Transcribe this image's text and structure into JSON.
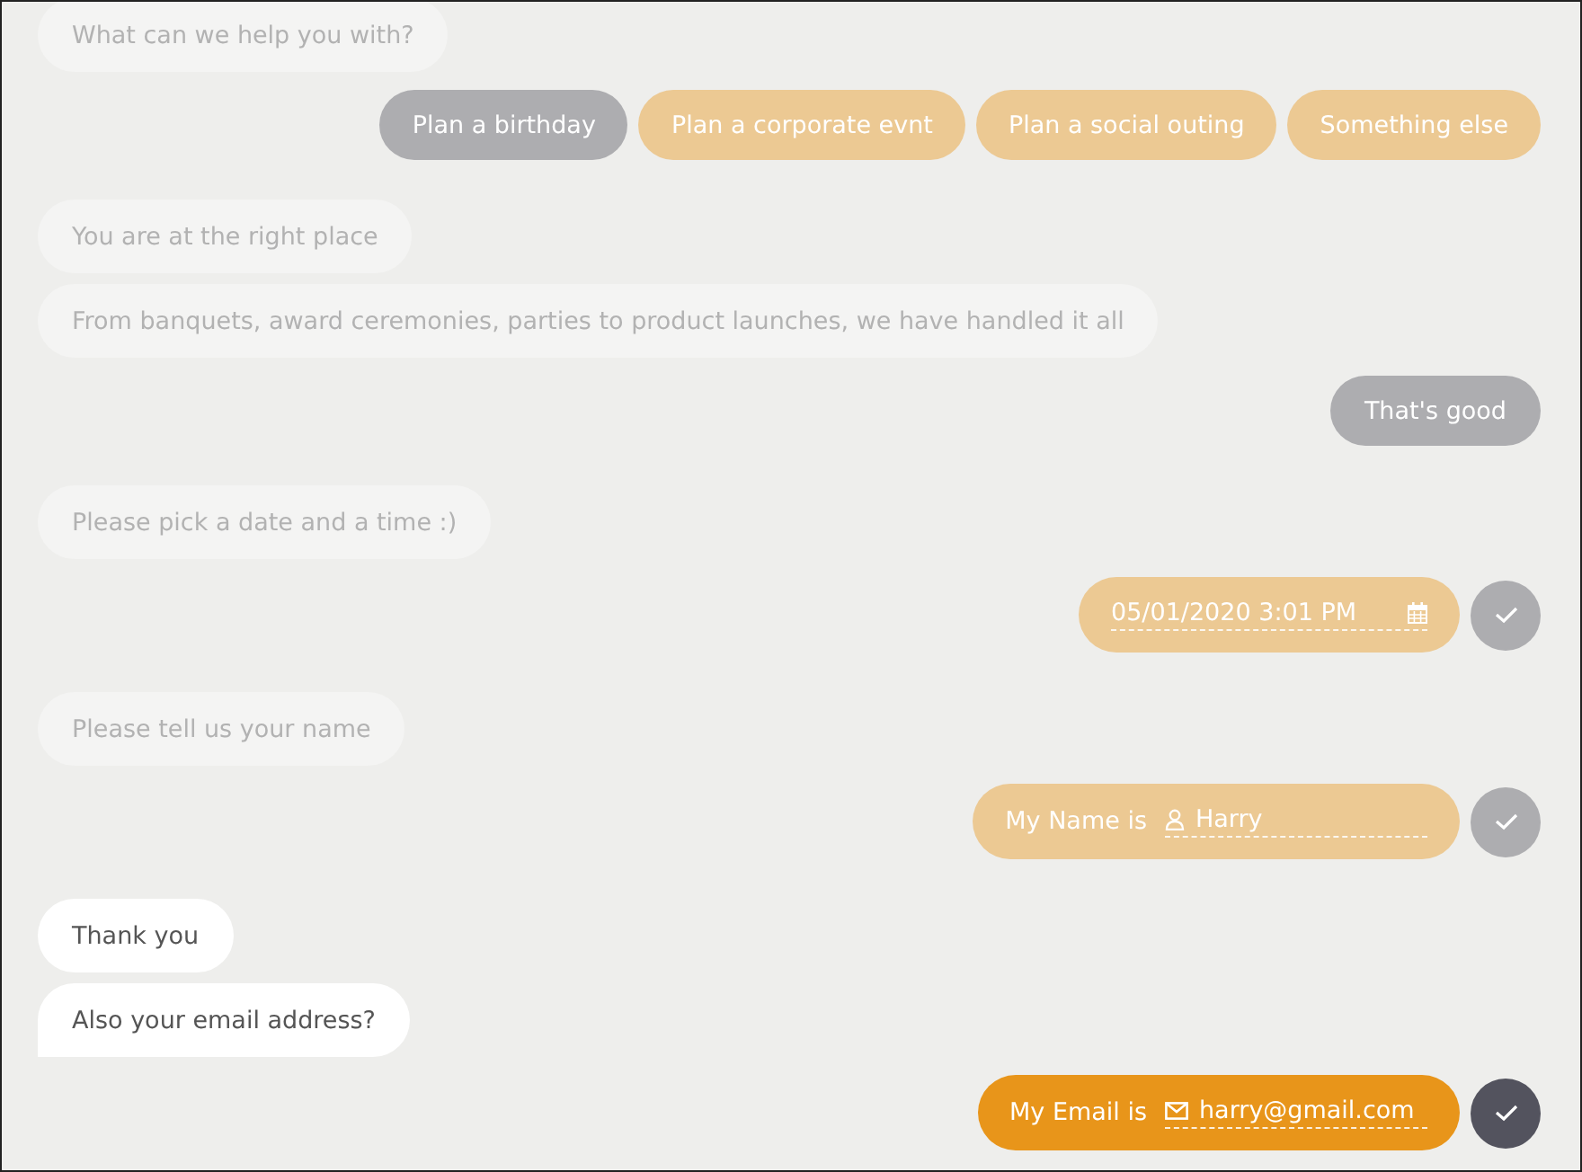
{
  "conversation": [
    {
      "kind": "bot",
      "faded": true,
      "messages": [
        "What can we help you with?"
      ]
    },
    {
      "kind": "options",
      "options": [
        {
          "label": "Plan a birthday",
          "selected": true
        },
        {
          "label": "Plan a corporate evnt",
          "selected": false
        },
        {
          "label": "Plan a social outing",
          "selected": false
        },
        {
          "label": "Something else",
          "selected": false
        }
      ]
    },
    {
      "kind": "bot",
      "faded": true,
      "messages": [
        "You are at the right place",
        "From banquets, award ceremonies, parties to product launches, we have handled it all"
      ]
    },
    {
      "kind": "reply",
      "text": "That's good"
    },
    {
      "kind": "bot",
      "faded": true,
      "messages": [
        "Please pick a date and a time :)"
      ]
    },
    {
      "kind": "input",
      "active": false,
      "field": {
        "kind": "datetime",
        "value": "05/01/2020 3:01 PM"
      }
    },
    {
      "kind": "bot",
      "faded": true,
      "messages": [
        "Please tell us your name"
      ]
    },
    {
      "kind": "input",
      "active": false,
      "label": "My Name is",
      "field": {
        "kind": "name",
        "value": "Harry"
      }
    },
    {
      "kind": "bot",
      "faded": false,
      "messages": [
        "Thank you",
        "Also your email address?"
      ]
    },
    {
      "kind": "input",
      "active": true,
      "label": "My Email is",
      "field": {
        "kind": "email",
        "value": "harry@gmail.com"
      }
    }
  ]
}
